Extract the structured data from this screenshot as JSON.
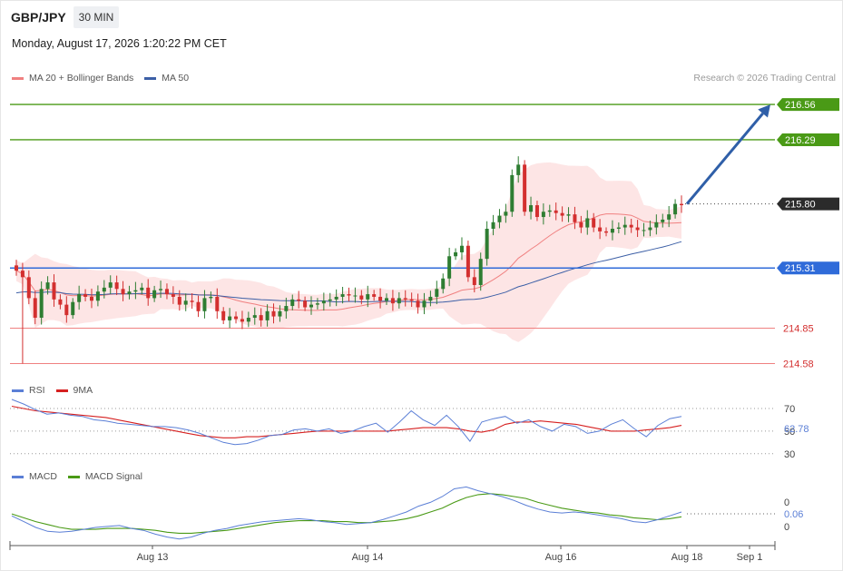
{
  "header": {
    "symbol": "GBP/JPY",
    "timeframe": "30 MIN",
    "datetime": "Monday, August 17, 2026 1:20:22 PM CET",
    "credit": "Research © 2026 Trading Central"
  },
  "colors": {
    "resistance": "#4a9a16",
    "pivot": "#2f6bd9",
    "support": "#f08080",
    "last": "#222222",
    "bull": "#2e7d32",
    "bear": "#d32f2f",
    "ma20": "#f08080",
    "ma50": "#3c5fa6",
    "band": "#fde0e0",
    "arrow": "#2f5fa8",
    "rsi": "#5b7fd6",
    "rsi_ma": "#d62020",
    "macd": "#5b7fd6",
    "macd_signal": "#4a9a16"
  },
  "chart_data": [
    {
      "type": "candlestick",
      "legend": [
        {
          "name": "MA 20 + Bollinger Bands",
          "color": "#f08080"
        },
        {
          "name": "MA 50",
          "color": "#3c5fa6"
        }
      ],
      "y_range": [
        214.5,
        216.72
      ],
      "levels": [
        {
          "value": 216.56,
          "label": "216.56",
          "kind": "resistance"
        },
        {
          "value": 216.29,
          "label": "216.29",
          "kind": "resistance"
        },
        {
          "value": 215.8,
          "label": "215.80",
          "kind": "last"
        },
        {
          "value": 215.31,
          "label": "215.31",
          "kind": "pivot"
        },
        {
          "value": 214.85,
          "label": "214.85",
          "kind": "support"
        },
        {
          "value": 214.58,
          "label": "214.58",
          "kind": "support"
        }
      ],
      "x_ticks": [
        "Aug 13",
        "Aug 14",
        "Aug 16",
        "Aug 18",
        "Sep 1"
      ],
      "close": [
        215.29,
        215.24,
        215.08,
        214.93,
        215.15,
        215.2,
        215.07,
        215.03,
        214.95,
        215.05,
        215.11,
        215.09,
        215.06,
        215.13,
        215.16,
        215.2,
        215.15,
        215.11,
        215.13,
        215.14,
        215.16,
        215.08,
        215.14,
        215.15,
        215.11,
        215.09,
        215.03,
        215.06,
        215.05,
        214.98,
        215.08,
        215.09,
        214.98,
        214.91,
        214.94,
        214.92,
        214.9,
        214.93,
        214.95,
        214.91,
        214.98,
        214.94,
        214.98,
        215.02,
        215.07,
        215.06,
        215.01,
        215.03,
        215.04,
        215.06,
        215.07,
        215.09,
        215.11,
        215.1,
        215.1,
        215.07,
        215.11,
        215.09,
        215.06,
        215.08,
        215.04,
        215.08,
        215.07,
        215.06,
        215.01,
        215.06,
        215.09,
        215.15,
        215.23,
        215.4,
        215.43,
        215.48,
        215.24,
        215.18,
        215.38,
        215.61,
        215.66,
        215.71,
        215.74,
        216.02,
        216.1,
        215.74,
        215.79,
        215.7,
        215.74,
        215.75,
        215.73,
        215.71,
        215.72,
        215.66,
        215.62,
        215.69,
        215.62,
        215.59,
        215.58,
        215.61,
        215.62,
        215.64,
        215.62,
        215.6,
        215.6,
        215.62,
        215.66,
        215.68,
        215.72,
        215.8,
        215.79
      ]
    },
    {
      "type": "line",
      "legend": [
        {
          "name": "RSI",
          "color": "#5b7fd6"
        },
        {
          "name": "9MA",
          "color": "#d62020"
        }
      ],
      "y_range": [
        25,
        78
      ],
      "y_ticks": [
        "70",
        "50",
        "30"
      ],
      "current_label": "62.78",
      "series_rsi": [
        78,
        74,
        69,
        65,
        66,
        64,
        63,
        60,
        59,
        57,
        56,
        55,
        54,
        54,
        53,
        51,
        48,
        44,
        40,
        38,
        39,
        42,
        46,
        47,
        51,
        52,
        50,
        52,
        48,
        50,
        54,
        57,
        49,
        58,
        68,
        60,
        55,
        64,
        54,
        41,
        58,
        61,
        63,
        57,
        60,
        54,
        50,
        56,
        54,
        48,
        50,
        56,
        60,
        52,
        45,
        55,
        61,
        63
      ],
      "series_ma": [
        72,
        70,
        68,
        67,
        66,
        65,
        64,
        63,
        62,
        60,
        58,
        56,
        54,
        52,
        50,
        48,
        46,
        45,
        44,
        44,
        45,
        45,
        46,
        47,
        48,
        49,
        50,
        50,
        50,
        50,
        50,
        50,
        50,
        51,
        52,
        53,
        53,
        53,
        52,
        50,
        49,
        51,
        56,
        58,
        58,
        59,
        58,
        57,
        56,
        54,
        52,
        50,
        50,
        50,
        51,
        52,
        53,
        55
      ]
    },
    {
      "type": "line",
      "legend": [
        {
          "name": "MACD",
          "color": "#5b7fd6"
        },
        {
          "name": "MACD Signal",
          "color": "#4a9a16"
        }
      ],
      "y_range": [
        -0.26,
        0.38
      ],
      "y_ticks": [
        "0",
        "0"
      ],
      "current_label": "0.06",
      "series_macd": [
        0.02,
        -0.04,
        -0.1,
        -0.14,
        -0.15,
        -0.14,
        -0.12,
        -0.1,
        -0.09,
        -0.08,
        -0.11,
        -0.13,
        -0.17,
        -0.2,
        -0.22,
        -0.2,
        -0.16,
        -0.13,
        -0.11,
        -0.08,
        -0.06,
        -0.04,
        -0.03,
        -0.02,
        -0.01,
        -0.02,
        -0.04,
        -0.05,
        -0.07,
        -0.06,
        -0.05,
        -0.02,
        0.02,
        0.06,
        0.12,
        0.16,
        0.22,
        0.3,
        0.32,
        0.28,
        0.25,
        0.22,
        0.18,
        0.13,
        0.09,
        0.06,
        0.05,
        0.06,
        0.05,
        0.03,
        0.01,
        -0.01,
        -0.04,
        -0.05,
        -0.02,
        0.02,
        0.06
      ],
      "series_signal": [
        0.04,
        0.0,
        -0.04,
        -0.07,
        -0.1,
        -0.12,
        -0.12,
        -0.12,
        -0.11,
        -0.11,
        -0.11,
        -0.12,
        -0.13,
        -0.15,
        -0.16,
        -0.16,
        -0.15,
        -0.14,
        -0.13,
        -0.11,
        -0.09,
        -0.07,
        -0.05,
        -0.04,
        -0.03,
        -0.03,
        -0.03,
        -0.04,
        -0.04,
        -0.05,
        -0.05,
        -0.04,
        -0.03,
        -0.01,
        0.02,
        0.06,
        0.1,
        0.16,
        0.21,
        0.24,
        0.25,
        0.24,
        0.22,
        0.2,
        0.16,
        0.13,
        0.1,
        0.08,
        0.06,
        0.05,
        0.03,
        0.02,
        0.0,
        -0.01,
        -0.02,
        -0.01,
        0.01
      ]
    }
  ]
}
